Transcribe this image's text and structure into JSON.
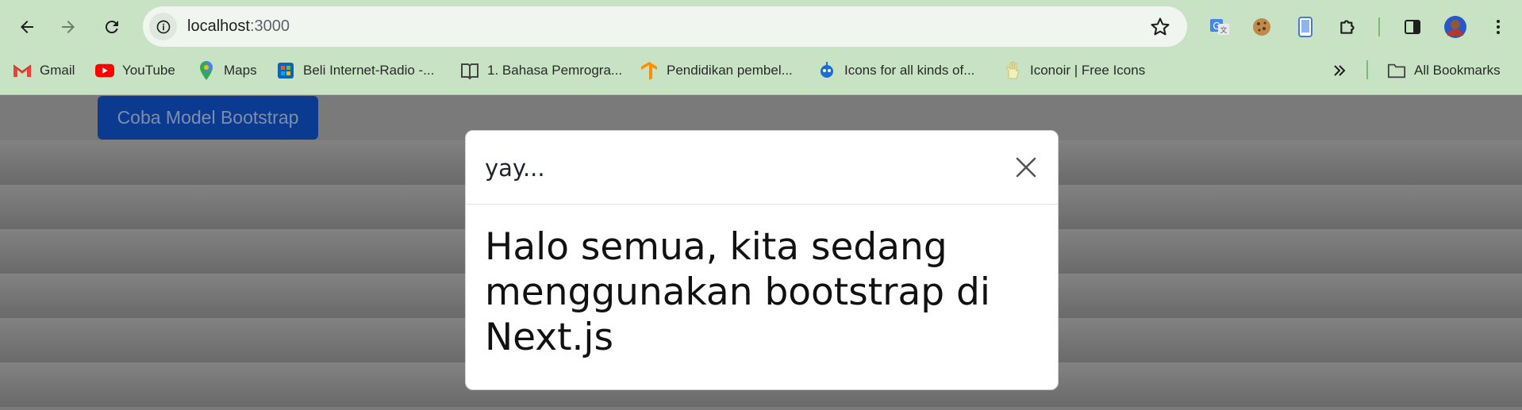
{
  "browser": {
    "address": {
      "host": "localhost",
      "port": ":3000"
    },
    "bookmarks": [
      {
        "label": "Gmail",
        "icon": "gmail-icon"
      },
      {
        "label": "YouTube",
        "icon": "youtube-icon"
      },
      {
        "label": "Maps",
        "icon": "maps-icon"
      },
      {
        "label": "Beli Internet-Radio -...",
        "icon": "radio-store-icon"
      },
      {
        "label": "1. Bahasa Pemrogra...",
        "icon": "book-icon"
      },
      {
        "label": "Pendidikan pembel...",
        "icon": "tensorflow-icon"
      },
      {
        "label": "Icons for all kinds of...",
        "icon": "icons-site-icon"
      },
      {
        "label": "Iconoir | Free Icons",
        "icon": "iconoir-icon"
      }
    ],
    "all_bookmarks_label": "All Bookmarks"
  },
  "page": {
    "trigger_button_label": "Coba Model Bootstrap"
  },
  "modal": {
    "title": "yay...",
    "body": "Halo semua, kita sedang menggunakan bootstrap di Next.js"
  },
  "colors": {
    "chrome_bg": "#c7e3c4",
    "primary_button": "#0b3b91",
    "backdrop": "#777777"
  }
}
